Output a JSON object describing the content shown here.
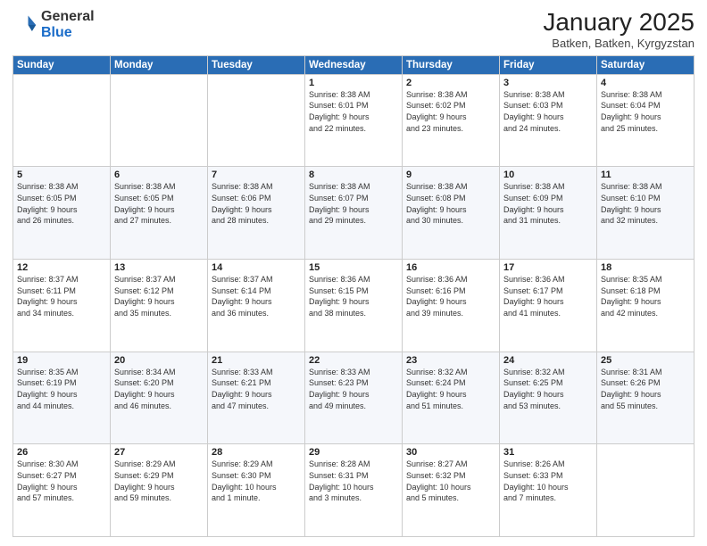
{
  "header": {
    "logo": {
      "general": "General",
      "blue": "Blue"
    },
    "title": "January 2025",
    "subtitle": "Batken, Batken, Kyrgyzstan"
  },
  "weekdays": [
    "Sunday",
    "Monday",
    "Tuesday",
    "Wednesday",
    "Thursday",
    "Friday",
    "Saturday"
  ],
  "weeks": [
    [
      {
        "day": "",
        "info": ""
      },
      {
        "day": "",
        "info": ""
      },
      {
        "day": "",
        "info": ""
      },
      {
        "day": "1",
        "info": "Sunrise: 8:38 AM\nSunset: 6:01 PM\nDaylight: 9 hours\nand 22 minutes."
      },
      {
        "day": "2",
        "info": "Sunrise: 8:38 AM\nSunset: 6:02 PM\nDaylight: 9 hours\nand 23 minutes."
      },
      {
        "day": "3",
        "info": "Sunrise: 8:38 AM\nSunset: 6:03 PM\nDaylight: 9 hours\nand 24 minutes."
      },
      {
        "day": "4",
        "info": "Sunrise: 8:38 AM\nSunset: 6:04 PM\nDaylight: 9 hours\nand 25 minutes."
      }
    ],
    [
      {
        "day": "5",
        "info": "Sunrise: 8:38 AM\nSunset: 6:05 PM\nDaylight: 9 hours\nand 26 minutes."
      },
      {
        "day": "6",
        "info": "Sunrise: 8:38 AM\nSunset: 6:05 PM\nDaylight: 9 hours\nand 27 minutes."
      },
      {
        "day": "7",
        "info": "Sunrise: 8:38 AM\nSunset: 6:06 PM\nDaylight: 9 hours\nand 28 minutes."
      },
      {
        "day": "8",
        "info": "Sunrise: 8:38 AM\nSunset: 6:07 PM\nDaylight: 9 hours\nand 29 minutes."
      },
      {
        "day": "9",
        "info": "Sunrise: 8:38 AM\nSunset: 6:08 PM\nDaylight: 9 hours\nand 30 minutes."
      },
      {
        "day": "10",
        "info": "Sunrise: 8:38 AM\nSunset: 6:09 PM\nDaylight: 9 hours\nand 31 minutes."
      },
      {
        "day": "11",
        "info": "Sunrise: 8:38 AM\nSunset: 6:10 PM\nDaylight: 9 hours\nand 32 minutes."
      }
    ],
    [
      {
        "day": "12",
        "info": "Sunrise: 8:37 AM\nSunset: 6:11 PM\nDaylight: 9 hours\nand 34 minutes."
      },
      {
        "day": "13",
        "info": "Sunrise: 8:37 AM\nSunset: 6:12 PM\nDaylight: 9 hours\nand 35 minutes."
      },
      {
        "day": "14",
        "info": "Sunrise: 8:37 AM\nSunset: 6:14 PM\nDaylight: 9 hours\nand 36 minutes."
      },
      {
        "day": "15",
        "info": "Sunrise: 8:36 AM\nSunset: 6:15 PM\nDaylight: 9 hours\nand 38 minutes."
      },
      {
        "day": "16",
        "info": "Sunrise: 8:36 AM\nSunset: 6:16 PM\nDaylight: 9 hours\nand 39 minutes."
      },
      {
        "day": "17",
        "info": "Sunrise: 8:36 AM\nSunset: 6:17 PM\nDaylight: 9 hours\nand 41 minutes."
      },
      {
        "day": "18",
        "info": "Sunrise: 8:35 AM\nSunset: 6:18 PM\nDaylight: 9 hours\nand 42 minutes."
      }
    ],
    [
      {
        "day": "19",
        "info": "Sunrise: 8:35 AM\nSunset: 6:19 PM\nDaylight: 9 hours\nand 44 minutes."
      },
      {
        "day": "20",
        "info": "Sunrise: 8:34 AM\nSunset: 6:20 PM\nDaylight: 9 hours\nand 46 minutes."
      },
      {
        "day": "21",
        "info": "Sunrise: 8:33 AM\nSunset: 6:21 PM\nDaylight: 9 hours\nand 47 minutes."
      },
      {
        "day": "22",
        "info": "Sunrise: 8:33 AM\nSunset: 6:23 PM\nDaylight: 9 hours\nand 49 minutes."
      },
      {
        "day": "23",
        "info": "Sunrise: 8:32 AM\nSunset: 6:24 PM\nDaylight: 9 hours\nand 51 minutes."
      },
      {
        "day": "24",
        "info": "Sunrise: 8:32 AM\nSunset: 6:25 PM\nDaylight: 9 hours\nand 53 minutes."
      },
      {
        "day": "25",
        "info": "Sunrise: 8:31 AM\nSunset: 6:26 PM\nDaylight: 9 hours\nand 55 minutes."
      }
    ],
    [
      {
        "day": "26",
        "info": "Sunrise: 8:30 AM\nSunset: 6:27 PM\nDaylight: 9 hours\nand 57 minutes."
      },
      {
        "day": "27",
        "info": "Sunrise: 8:29 AM\nSunset: 6:29 PM\nDaylight: 9 hours\nand 59 minutes."
      },
      {
        "day": "28",
        "info": "Sunrise: 8:29 AM\nSunset: 6:30 PM\nDaylight: 10 hours\nand 1 minute."
      },
      {
        "day": "29",
        "info": "Sunrise: 8:28 AM\nSunset: 6:31 PM\nDaylight: 10 hours\nand 3 minutes."
      },
      {
        "day": "30",
        "info": "Sunrise: 8:27 AM\nSunset: 6:32 PM\nDaylight: 10 hours\nand 5 minutes."
      },
      {
        "day": "31",
        "info": "Sunrise: 8:26 AM\nSunset: 6:33 PM\nDaylight: 10 hours\nand 7 minutes."
      },
      {
        "day": "",
        "info": ""
      }
    ]
  ]
}
